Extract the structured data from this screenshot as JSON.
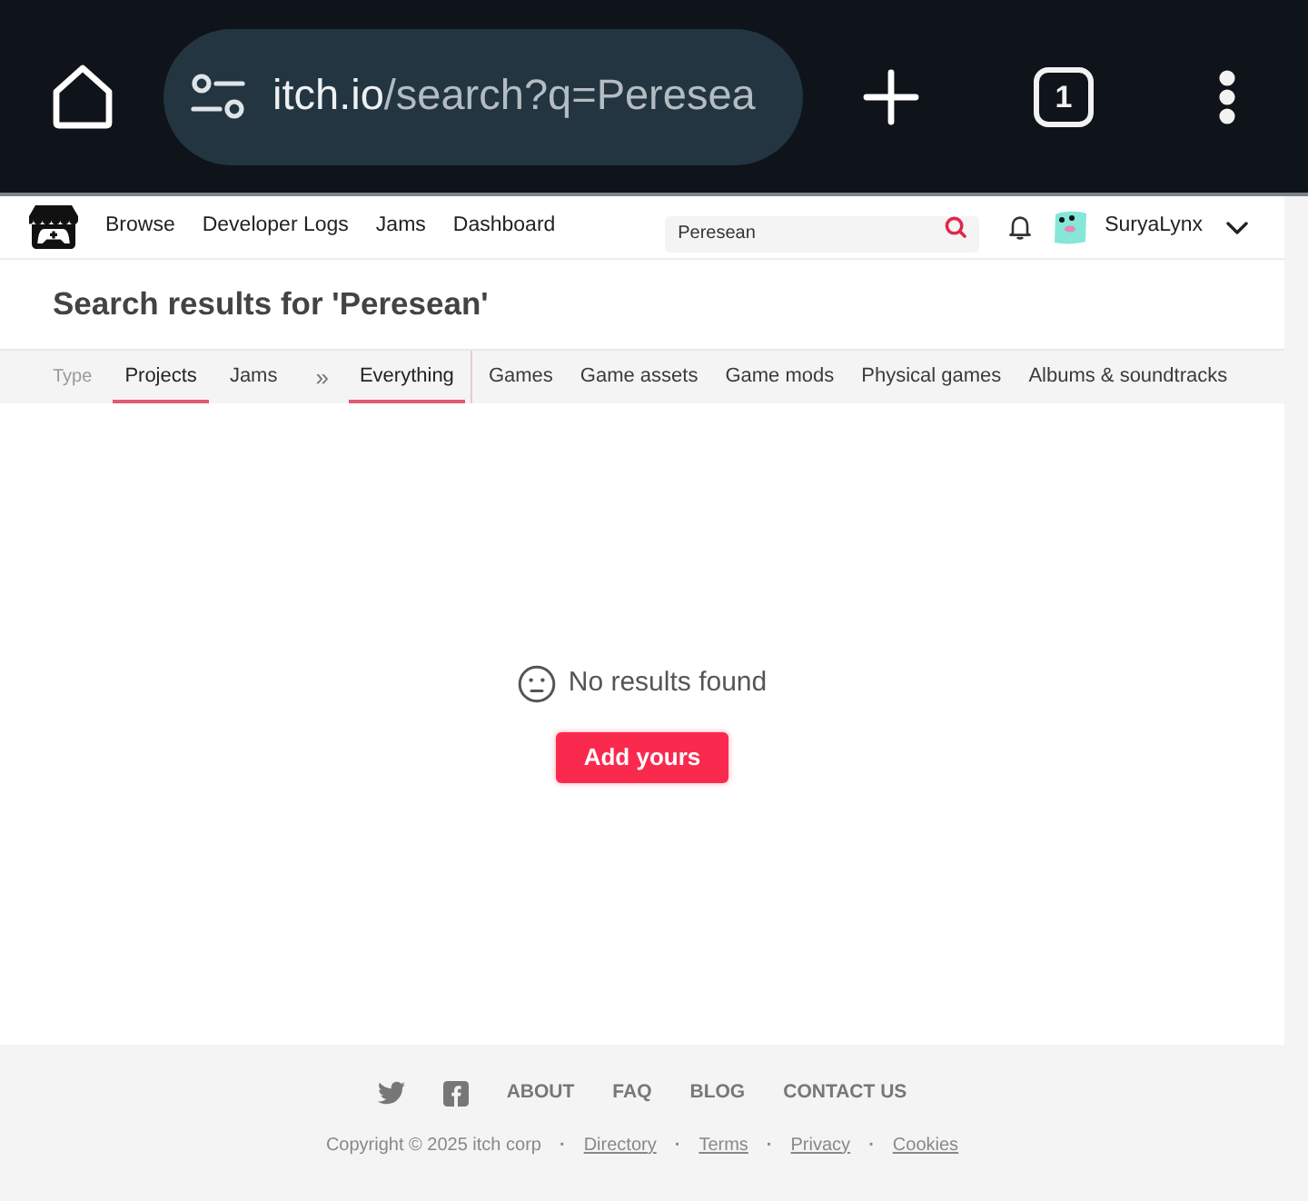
{
  "browser": {
    "url_host": "itch.io",
    "url_path": "/search?q=Peresea",
    "tab_count": "1"
  },
  "header": {
    "nav": [
      "Browse",
      "Developer Logs",
      "Jams",
      "Dashboard"
    ],
    "search": {
      "value": "Peresean"
    },
    "username": "SuryaLynx"
  },
  "title": "Search results for 'Peresean'",
  "filters": {
    "label": "Type",
    "separator": "»",
    "groups": [
      {
        "tabs": [
          {
            "label": "Projects",
            "selected": true
          },
          {
            "label": "Jams",
            "selected": false
          }
        ]
      },
      {
        "tabs": [
          {
            "label": "Everything",
            "selected": true
          },
          {
            "label": "Games",
            "selected": false
          },
          {
            "label": "Game assets",
            "selected": false
          },
          {
            "label": "Game mods",
            "selected": false
          },
          {
            "label": "Physical games",
            "selected": false
          },
          {
            "label": "Albums & soundtracks",
            "selected": false
          }
        ]
      }
    ]
  },
  "empty_state": {
    "message": "No results found",
    "button": "Add yours"
  },
  "footer": {
    "links": [
      "ABOUT",
      "FAQ",
      "BLOG",
      "CONTACT US"
    ],
    "copyright": "Copyright © 2025 itch corp",
    "separator": "·",
    "legal_links": [
      "Directory",
      "Terms",
      "Privacy",
      "Cookies"
    ]
  }
}
